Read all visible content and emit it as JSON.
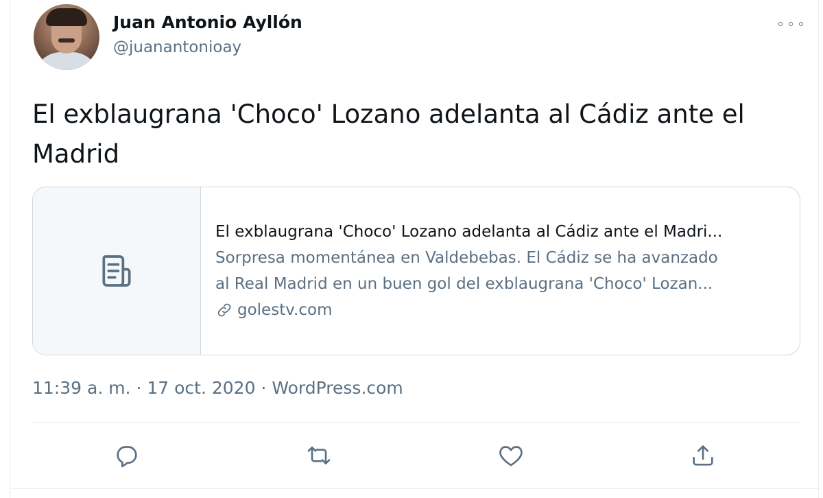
{
  "tweet": {
    "author_name": "Juan Antonio Ayllón",
    "author_handle": "@juanantonioay",
    "text": "El exblaugrana 'Choco' Lozano adelanta al Cádiz ante el Madrid",
    "card": {
      "icon": "document-icon",
      "title": "El exblaugrana 'Choco' Lozano adelanta al Cádiz ante el Madri...",
      "description_line1": "Sorpresa momentánea en Valdebebas. El Cádiz se ha avanzado",
      "description_line2": "al Real Madrid en un buen gol del exblaugrana 'Choco' Lozan...",
      "domain": "golestv.com"
    },
    "time": "11:39 a. m.",
    "separator": " · ",
    "date": "17 oct. 2020",
    "source": "WordPress.com"
  },
  "actions": {
    "reply_icon": "reply-icon",
    "retweet_icon": "retweet-icon",
    "like_icon": "heart-icon",
    "share_icon": "share-icon"
  },
  "colors": {
    "text_primary": "#0f1419",
    "text_secondary": "#5b7083",
    "border": "#cfd9de"
  }
}
